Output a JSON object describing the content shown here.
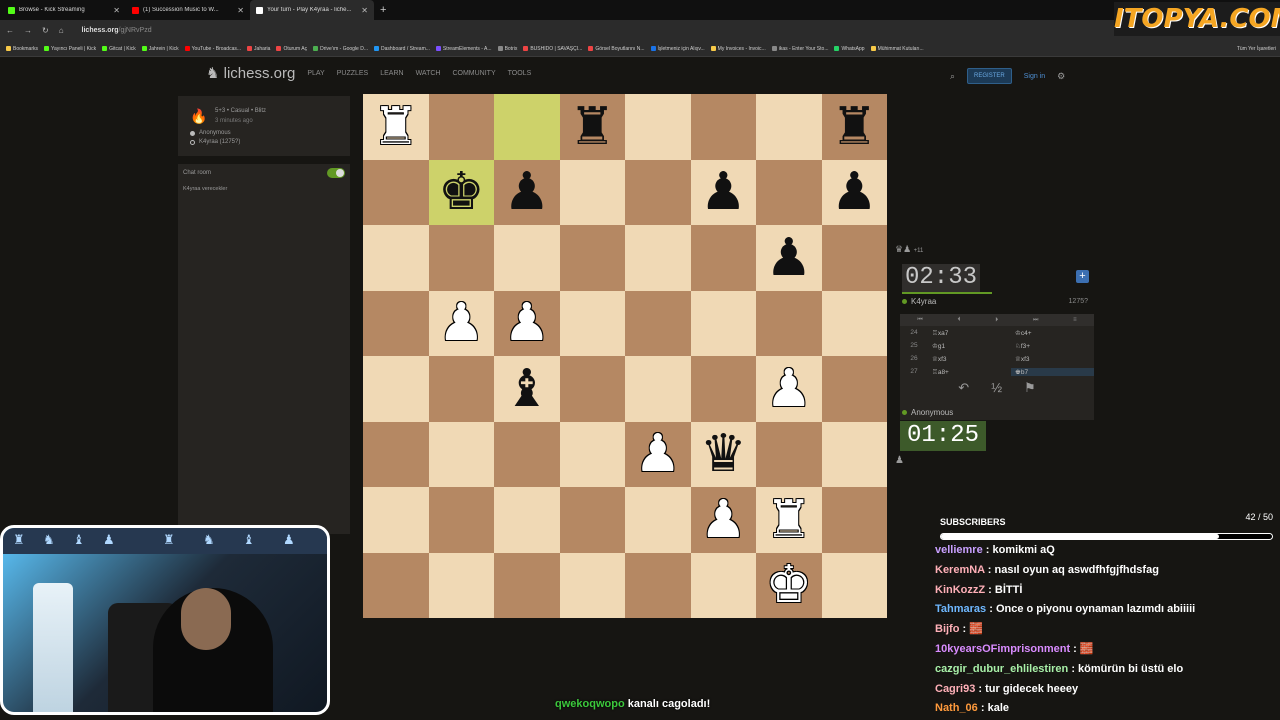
{
  "browser": {
    "tabs": [
      {
        "title": "Browse - Kick Streaming",
        "color": "#53fc18"
      },
      {
        "title": "(1) Succession Music to W...",
        "color": "#ff0000"
      },
      {
        "title": "Your turn - Play K4yraa - liche...",
        "color": "#ffffff"
      }
    ],
    "url": "lichess.org",
    "url_path": "/gjNRvPzd",
    "bookmarks": [
      "Bookmarks",
      "Yayıncı Paneli | Kick",
      "Gitcat | Kick",
      "Jahrein | Kick",
      "YouTube - Broadcas...",
      "Jaharia",
      "Oturum Aç",
      "Drive'ım - Google D...",
      "Dashboard / Stream...",
      "StreamElements - A...",
      "Botrix",
      "BUSHIDO | SAVAŞÇI...",
      "Görsel Boyutlarını N...",
      "İşletmeniz için Alışv...",
      "My Invoices - Invoic...",
      "ikas - Enter Your Sto...",
      "WhatsApp",
      "Mühimmat Kutuları..."
    ],
    "all_bookmarks": "Tüm Yer İşaretleri"
  },
  "watermark": "ITOPYA.COM",
  "lichess": {
    "brand": "lichess.org",
    "nav": [
      "PLAY",
      "PUZZLES",
      "LEARN",
      "WATCH",
      "COMMUNITY",
      "TOOLS"
    ],
    "register": "REGISTER",
    "sign_in": "Sign in"
  },
  "game": {
    "meta": "5+3 • Casual • Blitz",
    "ago": "3 minutes ago",
    "white_player": "Anonymous",
    "black_player": "K4yraa (1275?)"
  },
  "chat": {
    "title": "Chat room",
    "message": "K4yraa  verecekler"
  },
  "board": {
    "highlight": [
      "c8",
      "b7"
    ],
    "pieces": [
      {
        "sq": "a8",
        "p": "♜",
        "c": "w"
      },
      {
        "sq": "d8",
        "p": "♜",
        "c": "b"
      },
      {
        "sq": "h8",
        "p": "♜",
        "c": "b"
      },
      {
        "sq": "b7",
        "p": "♚",
        "c": "b"
      },
      {
        "sq": "c7",
        "p": "♟",
        "c": "b"
      },
      {
        "sq": "f7",
        "p": "♟",
        "c": "b"
      },
      {
        "sq": "h7",
        "p": "♟",
        "c": "b"
      },
      {
        "sq": "g6",
        "p": "♟",
        "c": "b"
      },
      {
        "sq": "b5",
        "p": "♟",
        "c": "w"
      },
      {
        "sq": "c5",
        "p": "♟",
        "c": "w"
      },
      {
        "sq": "c4",
        "p": "♝",
        "c": "b"
      },
      {
        "sq": "g4",
        "p": "♟",
        "c": "w"
      },
      {
        "sq": "e3",
        "p": "♟",
        "c": "w"
      },
      {
        "sq": "f3",
        "p": "♛",
        "c": "b"
      },
      {
        "sq": "f2",
        "p": "♟",
        "c": "w"
      },
      {
        "sq": "g2",
        "p": "♜",
        "c": "w"
      },
      {
        "sq": "g1",
        "p": "♚",
        "c": "w"
      }
    ]
  },
  "clock_panel": {
    "captured_top": "♛♟",
    "captured_diff": "+11",
    "top_time": "02:33",
    "top_player": "K4yraa",
    "top_rating": "1275?",
    "moves": [
      {
        "n": "24",
        "w": "♖xa7",
        "b": "♔c4+"
      },
      {
        "n": "25",
        "w": "♔g1",
        "b": "♘f3+"
      },
      {
        "n": "26",
        "w": "♕xf3",
        "b": "♕xf3"
      },
      {
        "n": "27",
        "w": "♖a8+",
        "b": "♚b7"
      }
    ],
    "bottom_player": "Anonymous",
    "bottom_time": "01:25",
    "captured_bottom": "♟"
  },
  "subs": {
    "label": "SUBSCRIBERS",
    "count": "42 / 50",
    "progress": 0.84
  },
  "stream_chat": [
    {
      "user": "velliemre",
      "color": "#c9a0ff",
      "msg": "komikmi aQ"
    },
    {
      "user": "KeremNA",
      "color": "#ffb0b8",
      "msg": "nasıl oyun aq aswdfhfgjfhdsfag"
    },
    {
      "user": "KinKozzZ",
      "color": "#ffb0b8",
      "msg": "BİTTİ"
    },
    {
      "user": "Tahmaras",
      "color": "#6fb8ff",
      "msg": "Once o piyonu oynaman lazımdı abiiiii"
    },
    {
      "user": "Bijfo",
      "color": "#ffb0b8",
      "msg": "🧱"
    },
    {
      "user": "10kyearsOFimprisonment",
      "color": "#d98cff",
      "msg": "🧱"
    },
    {
      "user": "cazgir_dubur_ehlilestiren",
      "color": "#a8f0a8",
      "msg": "kömürün bi üstü elo"
    },
    {
      "user": "Cagri93",
      "color": "#ffb0b8",
      "msg": "tur gidecek heeey"
    },
    {
      "user": "Nath_06",
      "color": "#ff9a3c",
      "msg": "kale"
    }
  ],
  "banner": {
    "user": "qwekoqwopo",
    "text": " kanalı cagoladı!"
  }
}
